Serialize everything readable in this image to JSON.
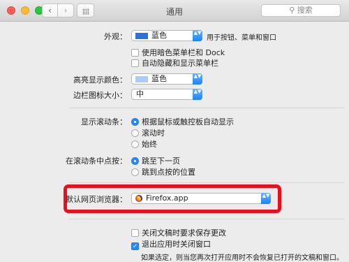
{
  "window": {
    "title": "通用",
    "back_glyph": "‹",
    "forward_glyph": "›",
    "grid_glyph": "⣿⣿",
    "search_glyph": "⚲",
    "search_placeholder": "搜索"
  },
  "appearance": {
    "label": "外观：",
    "value": "蓝色",
    "swatch_color": "#2b6fe0",
    "hint": "用于按钮、菜单和窗口",
    "dark_menu_label": "使用暗色菜单栏和 Dock",
    "dark_menu_checked": false,
    "autohide_label": "自动隐藏和显示菜单栏",
    "autohide_checked": false
  },
  "highlight_color": {
    "label": "高亮显示颜色：",
    "value": "蓝色",
    "swatch_color": "#a9cdf6"
  },
  "sidebar_icon_size": {
    "label": "边栏图标大小：",
    "value": "中"
  },
  "show_scroll_bars": {
    "label": "显示滚动条：",
    "options": [
      {
        "label": "根据鼠标或触控板自动显示",
        "selected": true
      },
      {
        "label": "滚动时",
        "selected": false
      },
      {
        "label": "始终",
        "selected": false
      }
    ]
  },
  "click_scroll_bar": {
    "label": "在滚动条中点按：",
    "options": [
      {
        "label": "跳至下一页",
        "selected": true
      },
      {
        "label": "跳到点按的位置",
        "selected": false
      }
    ]
  },
  "default_browser": {
    "label": "默认网页浏览器：",
    "value": "Firefox.app",
    "highlight_border_color": "#e8101e"
  },
  "documents": {
    "ask_keep_changes_label": "关闭文稿时要求保存更改",
    "ask_keep_changes_checked": false,
    "close_windows_label": "退出应用时关闭窗口",
    "close_windows_checked": true,
    "note": "如果选定，则当您再次打开应用时不会恢复已打开的文稿和窗口。"
  },
  "glyphs": {
    "check": "✓",
    "popup_arrows": "▲▼"
  },
  "colors": {
    "accent": "#2a88f5",
    "window_bg": "#ececec"
  }
}
